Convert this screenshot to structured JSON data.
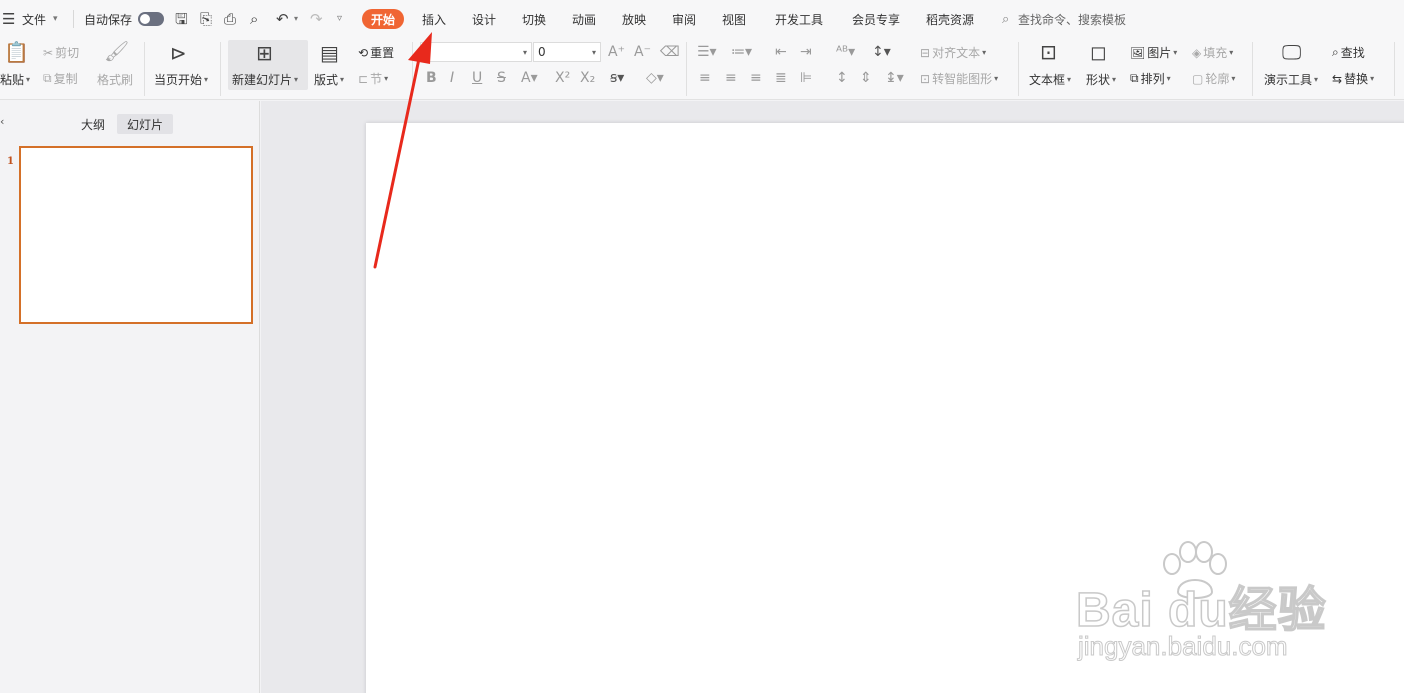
{
  "menubar": {
    "file_label": "文件",
    "autosave_label": "自动保存",
    "tabs": [
      "开始",
      "插入",
      "设计",
      "切换",
      "动画",
      "放映",
      "审阅",
      "视图",
      "开发工具",
      "会员专享",
      "稻壳资源"
    ],
    "search_placeholder": "查找命令、搜索模板",
    "accent_color": "#f06533"
  },
  "ribbon": {
    "paste": "粘贴",
    "cut": "剪切",
    "copy": "复制",
    "format_painter": "格式刷",
    "start_from_current": "当页开始",
    "new_slide": "新建幻灯片",
    "layout": "版式",
    "reset": "重置",
    "section": "节",
    "font_size": "0",
    "align_text": "对齐文本",
    "smartart": "转智能图形",
    "textbox": "文本框",
    "shape": "形状",
    "picture": "图片",
    "fill": "填充",
    "arrange": "排列",
    "outline": "轮廓",
    "present_tools": "演示工具",
    "find": "查找",
    "replace": "替换"
  },
  "panel": {
    "outline_tab": "大纲",
    "slides_tab": "幻灯片",
    "slide_number": "1"
  },
  "watermark": {
    "brand": "Bai du经验",
    "site": "jingyan.baidu.com"
  }
}
